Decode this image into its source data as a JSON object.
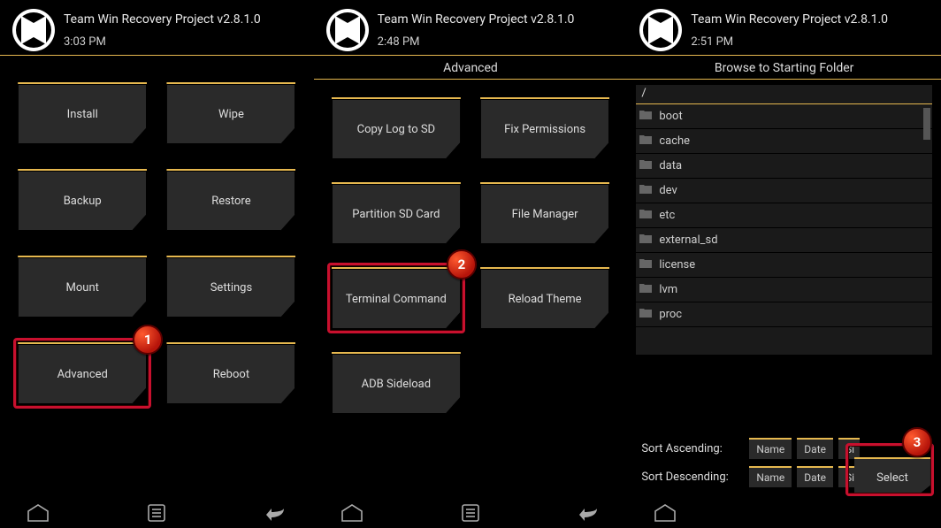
{
  "screens": [
    {
      "title": "Team Win Recovery Project  v2.8.1.0",
      "time": "3:03 PM",
      "subheader": null,
      "buttons": [
        {
          "label": "Install"
        },
        {
          "label": "Wipe"
        },
        {
          "label": "Backup"
        },
        {
          "label": "Restore"
        },
        {
          "label": "Mount"
        },
        {
          "label": "Settings"
        },
        {
          "label": "Advanced",
          "highlight": true
        },
        {
          "label": "Reboot"
        }
      ],
      "callout": {
        "number": "1"
      }
    },
    {
      "title": "Team Win Recovery Project  v2.8.1.0",
      "time": "2:48 PM",
      "subheader": "Advanced",
      "buttons": [
        {
          "label": "Copy Log to SD"
        },
        {
          "label": "Fix Permissions"
        },
        {
          "label": "Partition SD Card"
        },
        {
          "label": "File Manager"
        },
        {
          "label": "Terminal Command",
          "highlight": true
        },
        {
          "label": "Reload Theme"
        },
        {
          "label": "ADB Sideload"
        }
      ],
      "callout": {
        "number": "2"
      }
    },
    {
      "title": "Team Win Recovery Project  v2.8.1.0",
      "time": "2:51 PM",
      "subheader": "Browse to Starting Folder",
      "path": "/",
      "files": [
        "boot",
        "cache",
        "data",
        "dev",
        "etc",
        "external_sd",
        "license",
        "lvm",
        "proc"
      ],
      "sort_asc_label": "Sort Ascending:",
      "sort_desc_label": "Sort Descending:",
      "sort_btns_row1": [
        "Name",
        "Date",
        "Si"
      ],
      "sort_btns_row2": [
        "Name",
        "Date",
        "Size"
      ],
      "select_label": "Select",
      "callout": {
        "number": "3"
      }
    }
  ]
}
